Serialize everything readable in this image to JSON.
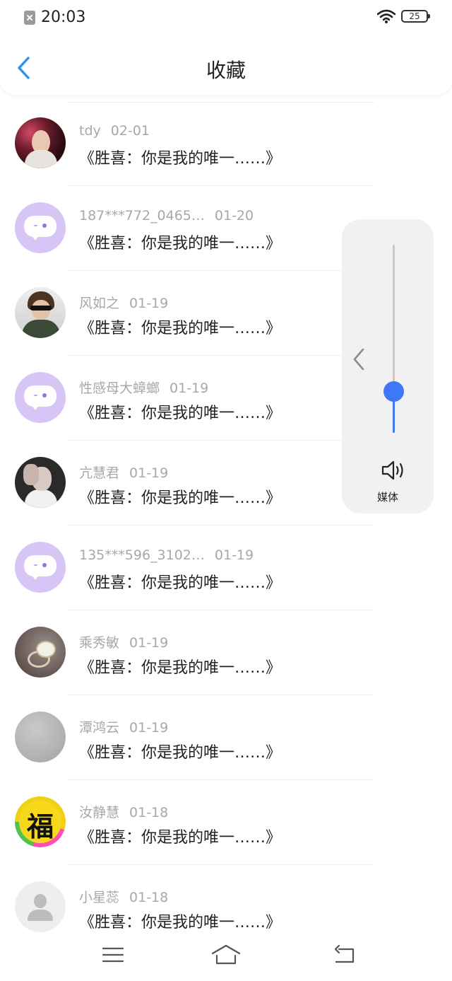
{
  "status_bar": {
    "time": "20:03",
    "battery": "25",
    "sim_icon": "sim-off-icon",
    "wifi_icon": "wifi-icon"
  },
  "header": {
    "title": "收藏",
    "back_icon": "chevron-left-icon"
  },
  "favorites": [
    {
      "name": "tdy",
      "date": "02-01",
      "content": "《胜喜：你是我的唯一……》",
      "avatar": "photo"
    },
    {
      "name": "187***772_0465…",
      "date": "01-20",
      "content": "《胜喜：你是我的唯一……》",
      "avatar": "chat-bubble"
    },
    {
      "name": "风如之",
      "date": "01-19",
      "content": "《胜喜：你是我的唯一……》",
      "avatar": "photo"
    },
    {
      "name": "性感母大蟑螂",
      "date": "01-19",
      "content": "《胜喜：你是我的唯一……》",
      "avatar": "chat-bubble"
    },
    {
      "name": "亢慧君",
      "date": "01-19",
      "content": "《胜喜：你是我的唯一……》",
      "avatar": "photo"
    },
    {
      "name": "135***596_3102…",
      "date": "01-19",
      "content": "《胜喜：你是我的唯一……》",
      "avatar": "chat-bubble"
    },
    {
      "name": "乘秀敏",
      "date": "01-19",
      "content": "《胜喜：你是我的唯一……》",
      "avatar": "photo"
    },
    {
      "name": "潭鸿云",
      "date": "01-19",
      "content": "《胜喜：你是我的唯一……》",
      "avatar": "photo"
    },
    {
      "name": "汝静慧",
      "date": "01-18",
      "content": "《胜喜：你是我的唯一……》",
      "avatar": "福"
    },
    {
      "name": "小星蕊",
      "date": "01-18",
      "content": "《胜喜：你是我的唯一……》",
      "avatar": "default-person"
    }
  ],
  "volume_panel": {
    "label": "媒体",
    "level": 0.22,
    "icon": "speaker-icon",
    "collapse_icon": "chevron-left-icon",
    "accent_color": "#3f78f5"
  },
  "nav_bar": {
    "menu_icon": "menu-icon",
    "home_icon": "home-icon",
    "back_icon": "return-icon"
  },
  "colors": {
    "accent": "#2f8ef5",
    "avatar_bubble": "#d7c6f5",
    "meta_text": "#a8a8a8"
  }
}
